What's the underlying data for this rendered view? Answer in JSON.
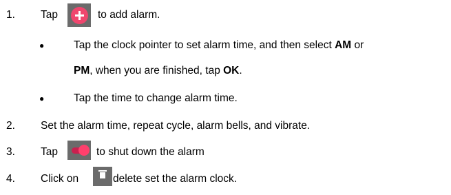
{
  "steps": [
    {
      "num": "1.",
      "pre": "Tap",
      "post": "to add alarm.",
      "icon": "add-icon"
    },
    {
      "num": "2.",
      "text": "Set the alarm time, repeat cycle, alarm bells, and vibrate."
    },
    {
      "num": "3.",
      "pre": "Tap",
      "post": "to shut down the alarm",
      "icon": "toggle-icon"
    },
    {
      "num": "4.",
      "pre": "Click on",
      "post": "delete set the alarm clock.",
      "icon": "delete-icon"
    }
  ],
  "bullet_glyph": "●",
  "sub": [
    {
      "line1_a": "Tap the clock pointer to set alarm time, and then select ",
      "line1_b": "AM",
      "line1_c": " or",
      "line2_a": "PM",
      "line2_b": ", when you are finished, tap ",
      "line2_c": "OK",
      "line2_d": "."
    },
    {
      "text": "Tap the time to change alarm time."
    }
  ],
  "colors": {
    "accent": "#f0466e",
    "icon_bg": "#6b6b6b"
  }
}
